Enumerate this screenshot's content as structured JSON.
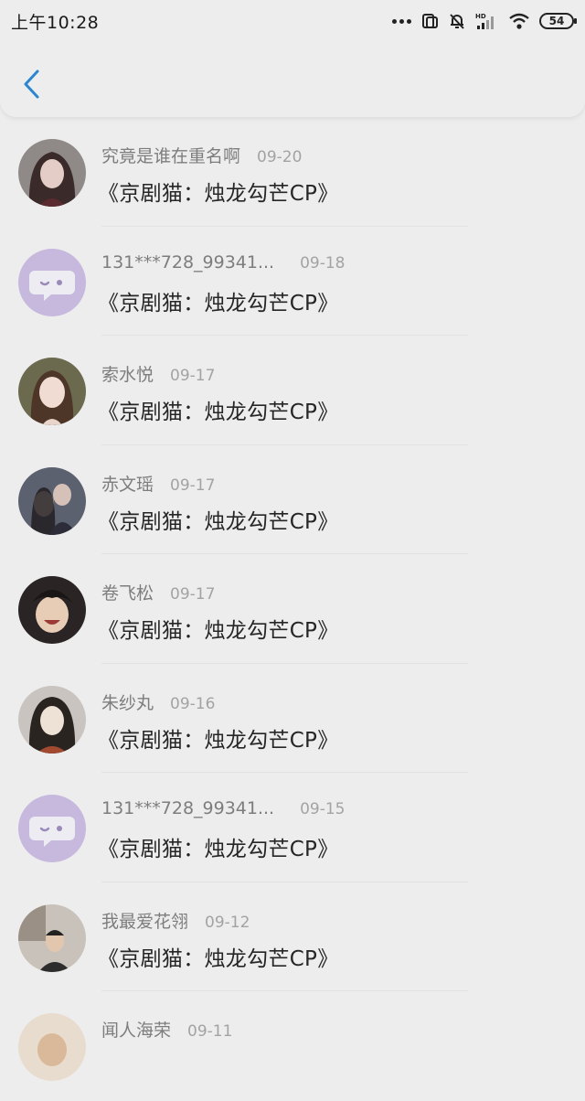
{
  "status": {
    "time": "上午10:28",
    "battery": "54",
    "icons": [
      "more-dots-icon",
      "nfc-icon",
      "mute-bell-icon",
      "hd-signal-icon",
      "wifi-icon",
      "battery-icon"
    ]
  },
  "nav": {
    "back_icon": "chevron-left-icon",
    "accent": "#2a86d1"
  },
  "list": [
    {
      "name": "究竟是谁在重名啊",
      "date": "09-20",
      "message": "《京剧猫：烛龙勾芒CP》",
      "avatar": "photo-dark-hair-girl"
    },
    {
      "name": "131***728_99341...",
      "date": "09-18",
      "message": "《京剧猫：烛龙勾芒CP》",
      "avatar": "default-chat-bubble"
    },
    {
      "name": "索水悦",
      "date": "09-17",
      "message": "《京剧猫：烛龙勾芒CP》",
      "avatar": "photo-girl-portrait"
    },
    {
      "name": "赤文瑶",
      "date": "09-17",
      "message": "《京剧猫：烛龙勾芒CP》",
      "avatar": "photo-couple"
    },
    {
      "name": "卷飞松",
      "date": "09-17",
      "message": "《京剧猫：烛龙勾芒CP》",
      "avatar": "photo-anime-smile"
    },
    {
      "name": "朱纱丸",
      "date": "09-16",
      "message": "《京剧猫：烛龙勾芒CP》",
      "avatar": "photo-anime-character"
    },
    {
      "name": "131***728_99341...",
      "date": "09-15",
      "message": "《京剧猫：烛龙勾芒CP》",
      "avatar": "default-chat-bubble"
    },
    {
      "name": "我最爱花翎",
      "date": "09-12",
      "message": "《京剧猫：烛龙勾芒CP》",
      "avatar": "photo-person-room"
    },
    {
      "name": "闻人海荣",
      "date": "09-11",
      "message": "",
      "avatar": "photo-partial"
    }
  ]
}
